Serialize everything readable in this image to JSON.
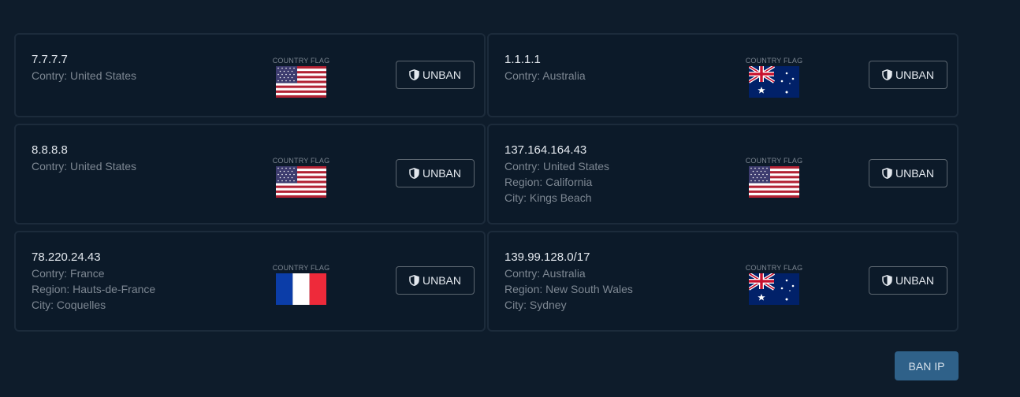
{
  "flag_label": "COUNTRY FLAG",
  "unban_label": "UNBAN",
  "ban_label": "BAN IP",
  "colors": {
    "background": "#0e1c2b",
    "card_border": "#1c2b3b",
    "ban_button": "#2f6189"
  },
  "bans": [
    {
      "ip": "7.7.7.7",
      "country": "Contry: United States",
      "flag": "us-flag-icon"
    },
    {
      "ip": "1.1.1.1",
      "country": "Contry: Australia",
      "flag": "au-flag-icon"
    },
    {
      "ip": "8.8.8.8",
      "country": "Contry: United States",
      "flag": "us-flag-icon"
    },
    {
      "ip": "137.164.164.43",
      "country": "Contry: United States",
      "region": "Region: California",
      "city": "City: Kings Beach",
      "flag": "us-flag-icon"
    },
    {
      "ip": "78.220.24.43",
      "country": "Contry: France",
      "region": "Region: Hauts-de-France",
      "city": "City: Coquelles",
      "flag": "fr-flag-icon"
    },
    {
      "ip": "139.99.128.0/17",
      "country": "Contry: Australia",
      "region": "Region: New South Wales",
      "city": "City: Sydney",
      "flag": "au-flag-icon"
    }
  ]
}
